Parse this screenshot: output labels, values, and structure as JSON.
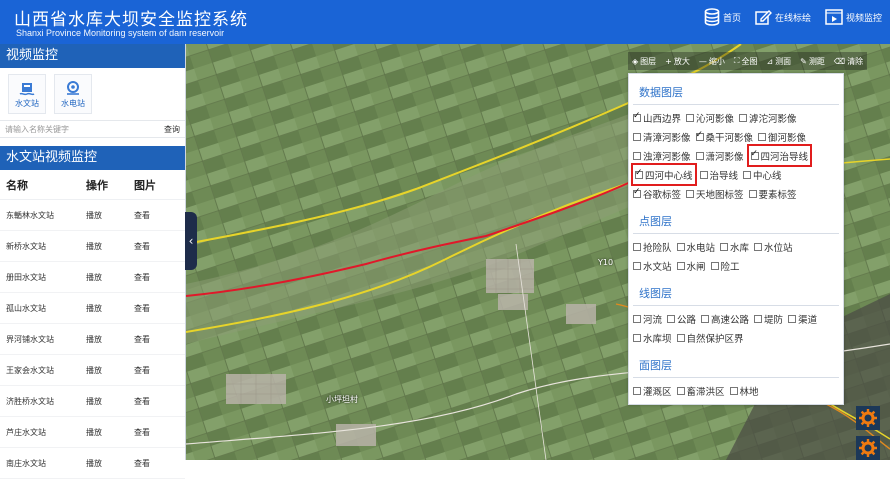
{
  "header": {
    "title": "山西省水库大坝安全监控系统",
    "subtitle": "Shanxi Province Monitoring system of dam reservoir",
    "nav": [
      {
        "label": "首页",
        "icon": "database-icon"
      },
      {
        "label": "在线标绘",
        "icon": "edit-icon"
      },
      {
        "label": "视频监控",
        "icon": "video-icon"
      }
    ]
  },
  "left": {
    "panel_title": "视频监控",
    "tiles": [
      {
        "label": "水文站",
        "icon": "hydrology-station-icon"
      },
      {
        "label": "水电站",
        "icon": "hydropower-station-icon"
      }
    ],
    "search": {
      "placeholder": "请输入名称关键字",
      "button": "查询"
    },
    "list_title": "水文站视频监控",
    "columns": [
      "名称",
      "操作",
      "图片"
    ],
    "rows": [
      {
        "name": "东輴林水文站",
        "play": "播放",
        "view": "查看"
      },
      {
        "name": "新桥水文站",
        "play": "播放",
        "view": "查看"
      },
      {
        "name": "册田水文站",
        "play": "播放",
        "view": "查看"
      },
      {
        "name": "孤山水文站",
        "play": "播放",
        "view": "查看"
      },
      {
        "name": "界河铺水文站",
        "play": "播放",
        "view": "查看"
      },
      {
        "name": "王家会水文站",
        "play": "播放",
        "view": "查看"
      },
      {
        "name": "济胜桥水文站",
        "play": "播放",
        "view": "查看"
      },
      {
        "name": "芦庄水文站",
        "play": "播放",
        "view": "查看"
      },
      {
        "name": "南庄水文站",
        "play": "播放",
        "view": "查看"
      }
    ]
  },
  "toolbar": [
    {
      "label": "图层",
      "icon": "layers-icon"
    },
    {
      "label": "放大",
      "icon": "zoom-in-icon"
    },
    {
      "label": "缩小",
      "icon": "zoom-out-icon"
    },
    {
      "label": "全图",
      "icon": "full-extent-icon"
    },
    {
      "label": "测面",
      "icon": "measure-area-icon"
    },
    {
      "label": "测距",
      "icon": "measure-distance-icon"
    },
    {
      "label": "清除",
      "icon": "clear-icon"
    }
  ],
  "layers": {
    "data_title": "数据图层",
    "data_items": [
      {
        "label": "山西边界",
        "checked": true,
        "highlight": false
      },
      {
        "label": "沁河影像",
        "checked": false,
        "highlight": false
      },
      {
        "label": "滹沱河影像",
        "checked": false,
        "highlight": false
      },
      {
        "label": "清漳河影像",
        "checked": false,
        "highlight": false
      },
      {
        "label": "桑干河影像",
        "checked": true,
        "highlight": false
      },
      {
        "label": "御河影像",
        "checked": false,
        "highlight": false
      },
      {
        "label": "浊漳河影像",
        "checked": false,
        "highlight": false
      },
      {
        "label": "潇河影像",
        "checked": false,
        "highlight": false
      },
      {
        "label": "四河治导线",
        "checked": true,
        "highlight": true
      },
      {
        "label": "四河中心线",
        "checked": true,
        "highlight": true
      },
      {
        "label": "治导线",
        "checked": false,
        "highlight": false
      },
      {
        "label": "中心线",
        "checked": false,
        "highlight": false
      },
      {
        "label": "谷歌标签",
        "checked": true,
        "highlight": false
      },
      {
        "label": "天地图标签",
        "checked": false,
        "highlight": false
      },
      {
        "label": "要素标签",
        "checked": false,
        "highlight": false
      }
    ],
    "point_title": "点图层",
    "point_items": [
      {
        "label": "抢险队",
        "checked": false
      },
      {
        "label": "水电站",
        "checked": false
      },
      {
        "label": "水库",
        "checked": false
      },
      {
        "label": "水位站",
        "checked": false
      },
      {
        "label": "水文站",
        "checked": false
      },
      {
        "label": "水闸",
        "checked": false
      },
      {
        "label": "险工",
        "checked": false
      }
    ],
    "line_title": "线图层",
    "line_items": [
      {
        "label": "河流",
        "checked": false
      },
      {
        "label": "公路",
        "checked": false
      },
      {
        "label": "高速公路",
        "checked": false
      },
      {
        "label": "堤防",
        "checked": false
      },
      {
        "label": "渠道",
        "checked": false
      },
      {
        "label": "水库坝",
        "checked": false
      },
      {
        "label": "自然保护区界",
        "checked": false
      }
    ],
    "area_title": "面图层",
    "area_items": [
      {
        "label": "灌溉区",
        "checked": false
      },
      {
        "label": "畜滞洪区",
        "checked": false
      },
      {
        "label": "林地",
        "checked": false
      }
    ]
  },
  "map_labels": [
    "Y10",
    "小坪坦村"
  ],
  "colors": {
    "header": "#1a64d6",
    "panel_head": "#1f62b8",
    "boundary": "#e7d42a",
    "centerline": "#e0182a",
    "highlight": "#e11d1d",
    "gear": "#f07a10"
  }
}
